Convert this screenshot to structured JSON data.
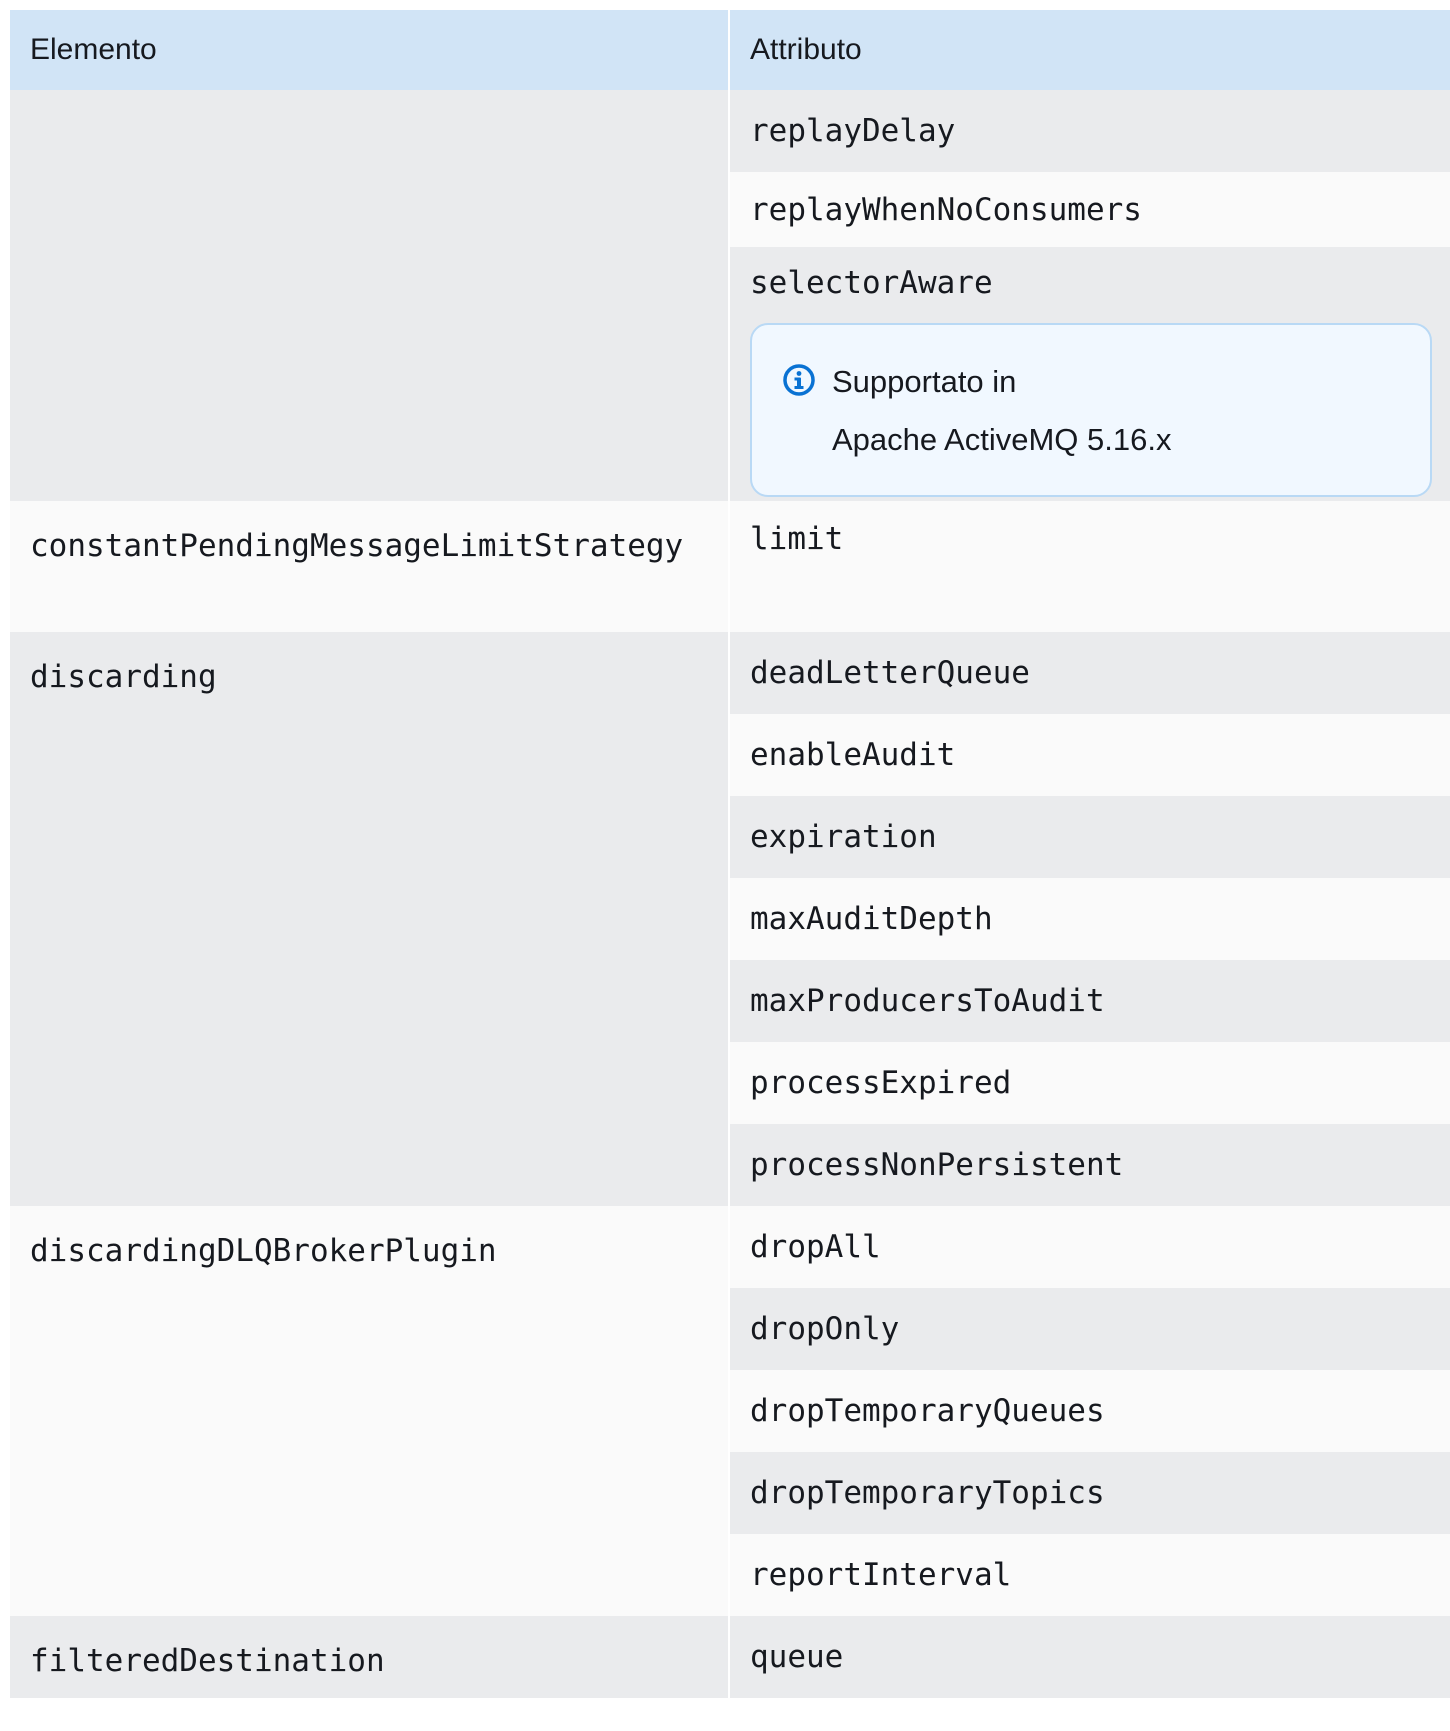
{
  "table": {
    "headers": [
      "Elemento",
      "Attributo"
    ],
    "rows": [
      {
        "element": "",
        "attributes": [
          "replayDelay",
          "replayWhenNoConsumers",
          "selectorAware"
        ],
        "note": {
          "line1": "Supportato in",
          "line2": "Apache ActiveMQ 5.16.x"
        }
      },
      {
        "element": "constantPendingMessageLimitStrategy",
        "attributes": [
          "limit"
        ]
      },
      {
        "element": "discarding",
        "attributes": [
          "deadLetterQueue",
          "enableAudit",
          "expiration",
          "maxAuditDepth",
          "maxProducersToAudit",
          "processExpired",
          "processNonPersistent"
        ]
      },
      {
        "element": "discardingDLQBrokerPlugin",
        "attributes": [
          "dropAll",
          "dropOnly",
          "dropTemporaryQueues",
          "dropTemporaryTopics",
          "reportInterval"
        ]
      },
      {
        "element": "filteredDestination",
        "attributes": [
          "queue"
        ]
      }
    ]
  },
  "colors": {
    "header_bg": "#d1e4f6",
    "row_a": "#eaebed",
    "row_b": "#fafafa",
    "note_bg": "#f1f8ff",
    "note_border": "#b9d9f5",
    "info_icon": "#0972d3"
  },
  "icons": {
    "note": "info-icon"
  }
}
